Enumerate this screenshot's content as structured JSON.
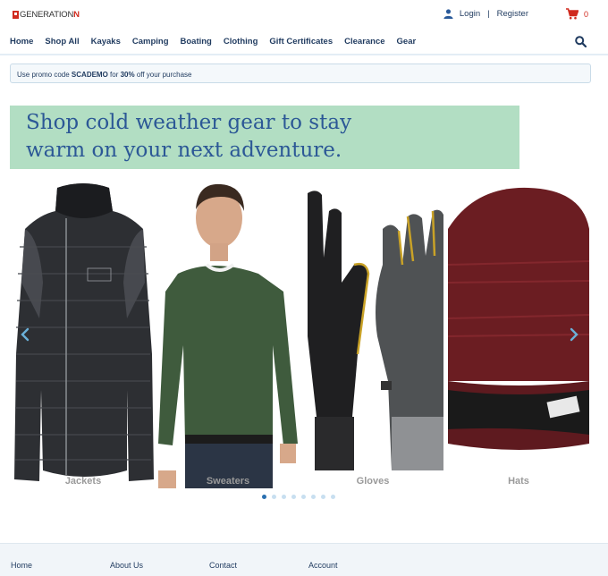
{
  "brand": {
    "prefix": "GENERATION",
    "suffix": "N"
  },
  "account": {
    "login": "Login",
    "separator": "|",
    "register": "Register",
    "cart_count": "0"
  },
  "nav": [
    {
      "label": "Home"
    },
    {
      "label": "Shop All"
    },
    {
      "label": "Kayaks"
    },
    {
      "label": "Camping"
    },
    {
      "label": "Boating"
    },
    {
      "label": "Clothing"
    },
    {
      "label": "Gift Certificates"
    },
    {
      "label": "Clearance"
    },
    {
      "label": "Gear"
    }
  ],
  "promo": {
    "before": "Use promo code ",
    "code": "SCADEMO",
    "middle": " for ",
    "percent": "30%",
    "after": " off your purchase"
  },
  "hero": {
    "line1": "Shop cold weather gear to stay",
    "line2": "warm on your next adventure."
  },
  "carousel": {
    "slides": [
      {
        "label": "Jackets"
      },
      {
        "label": "Sweaters"
      },
      {
        "label": "Gloves"
      },
      {
        "label": "Hats"
      }
    ],
    "dot_count": 8,
    "active_index": 0
  },
  "footer": {
    "links": [
      "Home",
      "About Us",
      "Contact",
      "Account"
    ]
  },
  "colors": {
    "brand_red": "#d02a1e",
    "navy": "#1f3a5f",
    "hero_bg": "#b2dec3",
    "hero_text": "#2c5896"
  }
}
